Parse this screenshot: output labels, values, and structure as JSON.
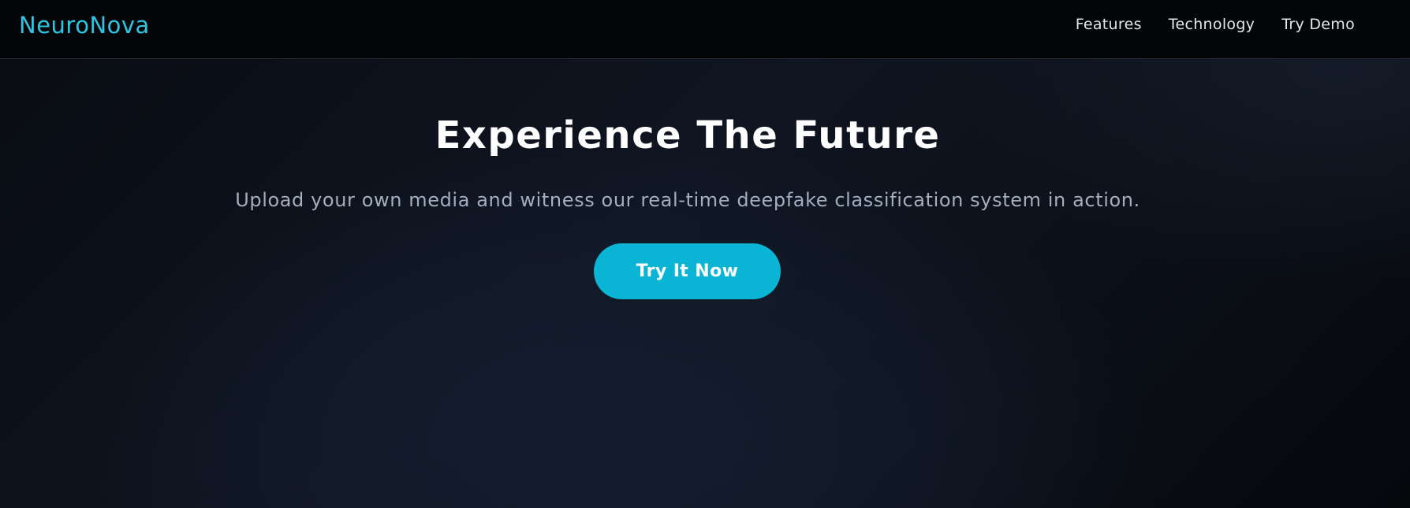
{
  "nav": {
    "logo": "NeuroNova",
    "links": [
      "Features",
      "Technology",
      "Try Demo"
    ]
  },
  "hero": {
    "title": "Experience The Future",
    "subtitle": "Upload your own media and witness our real-time deepfake classification system in action.",
    "cta_label": "Try It Now"
  },
  "colors": {
    "accent": "#09b4d4",
    "logo": "#2ec4e4",
    "background": "#0b0f17",
    "navbar": "#030405"
  }
}
